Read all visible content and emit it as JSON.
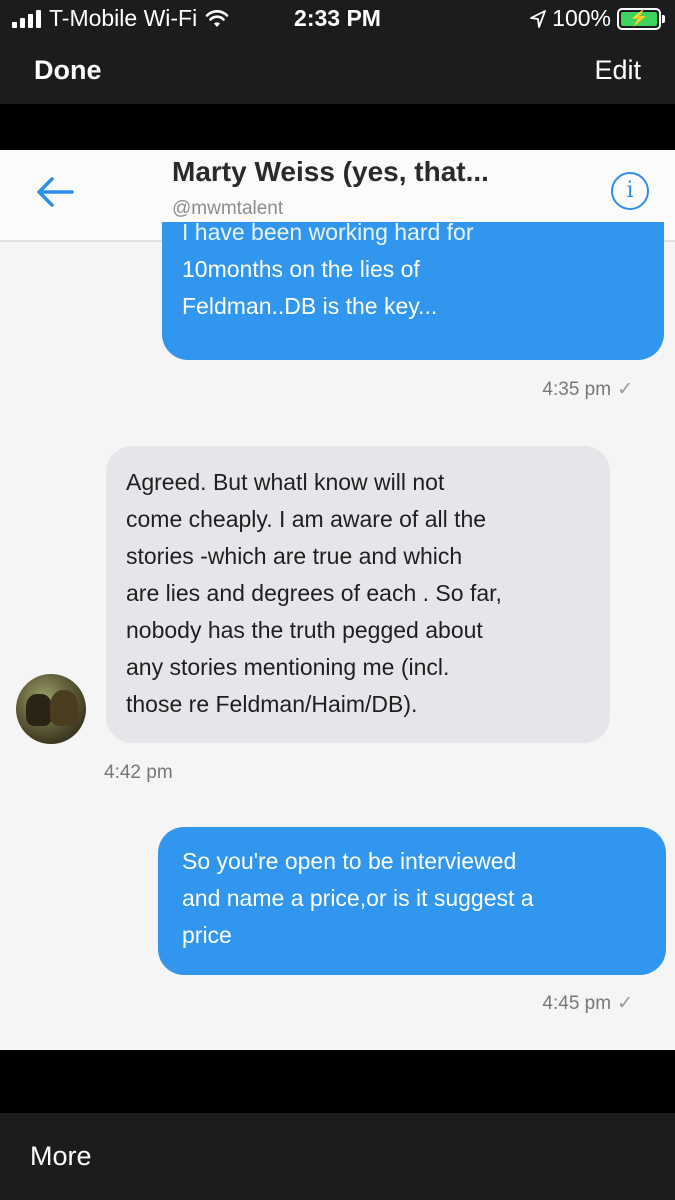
{
  "status_bar": {
    "carrier": "T-Mobile Wi-Fi",
    "time": "2:33 PM",
    "battery": "100%",
    "battery_level": 1.0
  },
  "nav": {
    "done_label": "Done",
    "edit_label": "Edit"
  },
  "chat": {
    "contact_name": "Marty Weiss (yes, that...",
    "contact_handle": "@mwmtalent",
    "info_glyph": "i",
    "messages": [
      {
        "direction": "outgoing",
        "lines": [
          "I have been working hard for",
          "10months on the lies of",
          "Feldman..DB is the key..."
        ],
        "time": "4:35 pm"
      },
      {
        "direction": "incoming",
        "lines": [
          "Agreed. But whatl know will not",
          "come cheaply. I am aware of all the",
          "stories -which are true and which",
          "are lies and degrees of each . So far,",
          "nobody has the truth pegged about",
          "any stories mentioning me (incl.",
          "those re Feldman/Haim/DB)."
        ],
        "time": "4:42 pm"
      },
      {
        "direction": "outgoing",
        "lines": [
          "So you're open to be interviewed",
          "and name a price,or is it suggest a",
          "price"
        ],
        "time": "4:45 pm"
      }
    ],
    "check_glyph": "✓"
  },
  "bottom_bar": {
    "more_label": "More"
  },
  "colors": {
    "outgoing_bubble": "#3197ee",
    "incoming_bubble": "#e6e6ea",
    "accent": "#2d8ee8"
  }
}
